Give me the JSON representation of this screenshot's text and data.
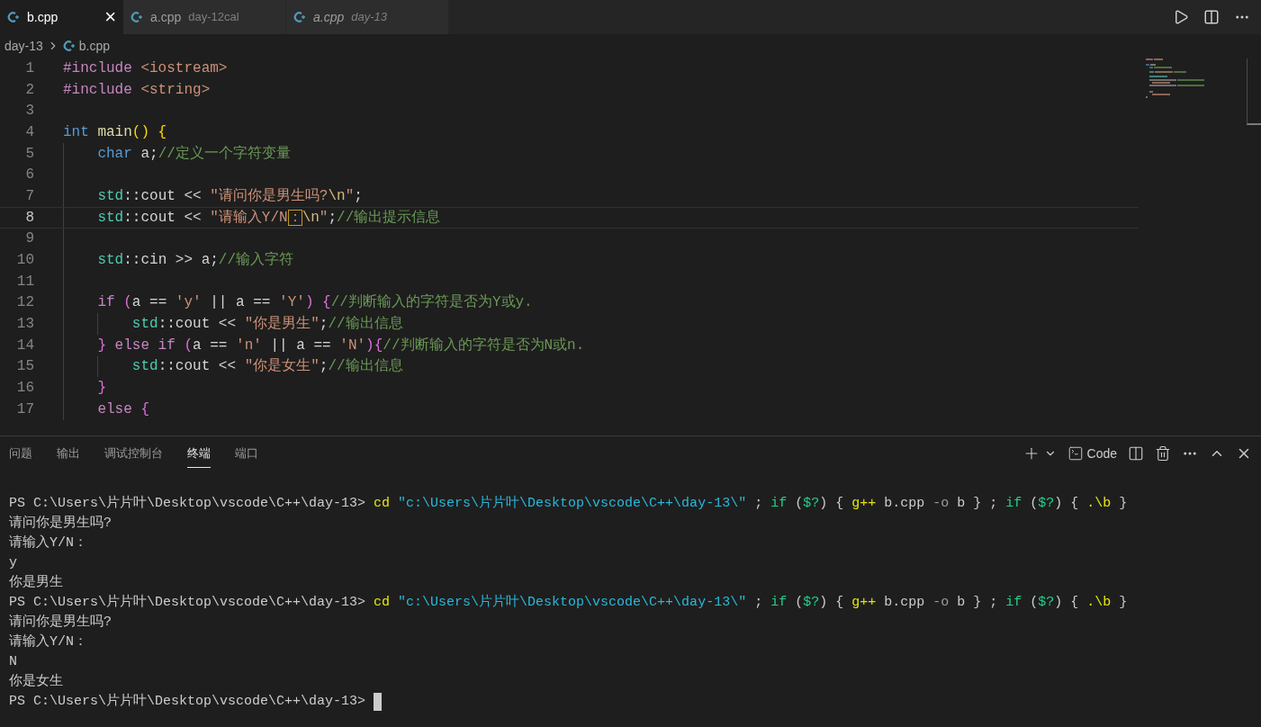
{
  "tabs": [
    {
      "label": "b.cpp",
      "selected": true,
      "preview": false,
      "close": "×"
    },
    {
      "label": "a.cpp",
      "description": "day-12cal",
      "selected": false,
      "preview": false
    },
    {
      "label": "a.cpp",
      "description": "day-13",
      "selected": false,
      "preview": true
    }
  ],
  "breadcrumb": [
    "day-13",
    "b.cpp"
  ],
  "editor": {
    "lines": [
      {
        "number": "1",
        "current": false,
        "tokens": [
          {
            "text": "#include",
            "kind": "kw"
          },
          {
            "text": " <iostream>",
            "kind": "str"
          }
        ]
      },
      {
        "number": "2",
        "current": false,
        "tokens": [
          {
            "text": "#include",
            "kind": "kw"
          },
          {
            "text": " <string>",
            "kind": "str"
          }
        ]
      },
      {
        "number": "3",
        "current": false
      },
      {
        "number": "4",
        "current": false,
        "tokens": [
          {
            "text": "int ",
            "kind": "type"
          },
          {
            "text": "main",
            "kind": "fn"
          },
          {
            "text": "() {",
            "kind": "b1"
          }
        ]
      },
      {
        "number": "5",
        "current": false,
        "tokens": [
          {
            "text": "    char",
            "kind": "type"
          },
          {
            "text": " a;",
            "kind": "txt"
          },
          {
            "text": "//定义一个字符变量",
            "kind": "cm"
          }
        ]
      },
      {
        "number": "6",
        "current": false
      },
      {
        "number": "7",
        "current": false,
        "tokens": [
          {
            "text": "    std",
            "kind": "ns"
          },
          {
            "text": "::cout << ",
            "kind": "txt"
          },
          {
            "text": "\"请问你是男生吗?",
            "kind": "str"
          },
          {
            "text": "\\n",
            "kind": "esc"
          },
          {
            "text": "\"",
            "kind": "str"
          },
          {
            "text": ";",
            "kind": "txt"
          }
        ]
      },
      {
        "number": "8",
        "current": true,
        "tokens": [
          {
            "text": "    std",
            "kind": "ns"
          },
          {
            "text": "::cout << ",
            "kind": "txt"
          },
          {
            "text": "\"请输入Y/N",
            "kind": "str"
          },
          {
            "text": "：",
            "kind": "mark"
          },
          {
            "text": "\\n",
            "kind": "esc"
          },
          {
            "text": "\"",
            "kind": "str"
          },
          {
            "text": ";",
            "kind": "txt"
          },
          {
            "text": "//输出提示信息",
            "kind": "cm"
          }
        ]
      },
      {
        "number": "9",
        "current": false
      },
      {
        "number": "10",
        "current": false,
        "tokens": [
          {
            "text": "    std",
            "kind": "ns"
          },
          {
            "text": "::cin >> a;",
            "kind": "txt"
          },
          {
            "text": "//输入字符",
            "kind": "cm"
          }
        ]
      },
      {
        "number": "11",
        "current": false
      },
      {
        "number": "12",
        "current": false,
        "tokens": [
          {
            "text": "    if ",
            "kind": "kw"
          },
          {
            "text": "(",
            "kind": "b2"
          },
          {
            "text": "a == ",
            "kind": "txt"
          },
          {
            "text": "'y'",
            "kind": "str"
          },
          {
            "text": " || a == ",
            "kind": "txt"
          },
          {
            "text": "'Y'",
            "kind": "str"
          },
          {
            "text": ") {",
            "kind": "b2"
          },
          {
            "text": "//判断输入的字符是否为Y或y.",
            "kind": "cm"
          }
        ]
      },
      {
        "number": "13",
        "current": false,
        "tokens": [
          {
            "text": "        std",
            "kind": "ns"
          },
          {
            "text": "::cout << ",
            "kind": "txt"
          },
          {
            "text": "\"你是男生\"",
            "kind": "str"
          },
          {
            "text": ";",
            "kind": "txt"
          },
          {
            "text": "//输出信息",
            "kind": "cm"
          }
        ]
      },
      {
        "number": "14",
        "current": false,
        "tokens": [
          {
            "text": "    } ",
            "kind": "b2"
          },
          {
            "text": "else if ",
            "kind": "kw"
          },
          {
            "text": "(",
            "kind": "b2"
          },
          {
            "text": "a == ",
            "kind": "txt"
          },
          {
            "text": "'n'",
            "kind": "str"
          },
          {
            "text": " || a == ",
            "kind": "txt"
          },
          {
            "text": "'N'",
            "kind": "str"
          },
          {
            "text": ")",
            "kind": "b2"
          },
          {
            "text": "{",
            "kind": "b2"
          },
          {
            "text": "//判断输入的字符是否为N或n.",
            "kind": "cm"
          }
        ]
      },
      {
        "number": "15",
        "current": false,
        "tokens": [
          {
            "text": "        std",
            "kind": "ns"
          },
          {
            "text": "::cout << ",
            "kind": "txt"
          },
          {
            "text": "\"你是女生\"",
            "kind": "str"
          },
          {
            "text": ";",
            "kind": "txt"
          },
          {
            "text": "//输出信息",
            "kind": "cm"
          }
        ]
      },
      {
        "number": "16",
        "current": false,
        "tokens": [
          {
            "text": "    }",
            "kind": "b2"
          }
        ]
      },
      {
        "number": "17",
        "current": false,
        "tokens": [
          {
            "text": "    else ",
            "kind": "kw"
          },
          {
            "text": "{",
            "kind": "b2"
          }
        ]
      }
    ]
  },
  "panel": {
    "tabs": [
      {
        "label": "问题",
        "selected": false
      },
      {
        "label": "输出",
        "selected": false
      },
      {
        "label": "调试控制台",
        "selected": false
      },
      {
        "label": "终端",
        "selected": true
      },
      {
        "label": "端口",
        "selected": false
      }
    ],
    "terminal_name": "Code"
  },
  "terminal": {
    "cursor": true,
    "lines": [
      {
        "tokens": [
          {
            "text": "PS C:\\Users\\片片叶\\Desktop\\vscode\\C++\\day-13> ",
            "kind": "txt"
          },
          {
            "text": "cd ",
            "kind": "cmd"
          },
          {
            "text": "\"c:\\Users\\片片叶\\Desktop\\vscode\\C++\\day-13\\\"",
            "kind": "path"
          },
          {
            "text": " ; ",
            "kind": "txt"
          },
          {
            "text": "if",
            "kind": "kw"
          },
          {
            "text": " (",
            "kind": "txt"
          },
          {
            "text": "$?",
            "kind": "kw"
          },
          {
            "text": ") { ",
            "kind": "txt"
          },
          {
            "text": "g++",
            "kind": "cmd"
          },
          {
            "text": " b.cpp ",
            "kind": "txt"
          },
          {
            "text": "-o",
            "kind": "op"
          },
          {
            "text": " b } ; ",
            "kind": "txt"
          },
          {
            "text": "if",
            "kind": "kw"
          },
          {
            "text": " (",
            "kind": "txt"
          },
          {
            "text": "$?",
            "kind": "kw"
          },
          {
            "text": ") { ",
            "kind": "txt"
          },
          {
            "text": ".\\b",
            "kind": "cmd"
          },
          {
            "text": " }",
            "kind": "txt"
          }
        ]
      },
      {
        "tokens": [
          {
            "text": "请问你是男生吗?",
            "kind": "txt"
          }
        ]
      },
      {
        "tokens": [
          {
            "text": "请输入Y/N：",
            "kind": "txt"
          }
        ]
      },
      {
        "tokens": [
          {
            "text": "y",
            "kind": "txt"
          }
        ]
      },
      {
        "tokens": [
          {
            "text": "你是男生",
            "kind": "txt"
          }
        ]
      },
      {
        "tokens": [
          {
            "text": "PS C:\\Users\\片片叶\\Desktop\\vscode\\C++\\day-13> ",
            "kind": "txt"
          },
          {
            "text": "cd ",
            "kind": "cmd"
          },
          {
            "text": "\"c:\\Users\\片片叶\\Desktop\\vscode\\C++\\day-13\\\"",
            "kind": "path"
          },
          {
            "text": " ; ",
            "kind": "txt"
          },
          {
            "text": "if",
            "kind": "kw"
          },
          {
            "text": " (",
            "kind": "txt"
          },
          {
            "text": "$?",
            "kind": "kw"
          },
          {
            "text": ") { ",
            "kind": "txt"
          },
          {
            "text": "g++",
            "kind": "cmd"
          },
          {
            "text": " b.cpp ",
            "kind": "txt"
          },
          {
            "text": "-o",
            "kind": "op"
          },
          {
            "text": " b } ; ",
            "kind": "txt"
          },
          {
            "text": "if",
            "kind": "kw"
          },
          {
            "text": " (",
            "kind": "txt"
          },
          {
            "text": "$?",
            "kind": "kw"
          },
          {
            "text": ") { ",
            "kind": "txt"
          },
          {
            "text": ".\\b",
            "kind": "cmd"
          },
          {
            "text": " }",
            "kind": "txt"
          }
        ]
      },
      {
        "tokens": [
          {
            "text": "请问你是男生吗?",
            "kind": "txt"
          }
        ]
      },
      {
        "tokens": [
          {
            "text": "请输入Y/N：",
            "kind": "txt"
          }
        ]
      },
      {
        "tokens": [
          {
            "text": "N",
            "kind": "txt"
          }
        ]
      },
      {
        "tokens": [
          {
            "text": "你是女生",
            "kind": "txt"
          }
        ]
      },
      {
        "tokens": [
          {
            "text": "PS C:\\Users\\片片叶\\Desktop\\vscode\\C++\\day-13> ",
            "kind": "txt"
          }
        ]
      }
    ]
  }
}
